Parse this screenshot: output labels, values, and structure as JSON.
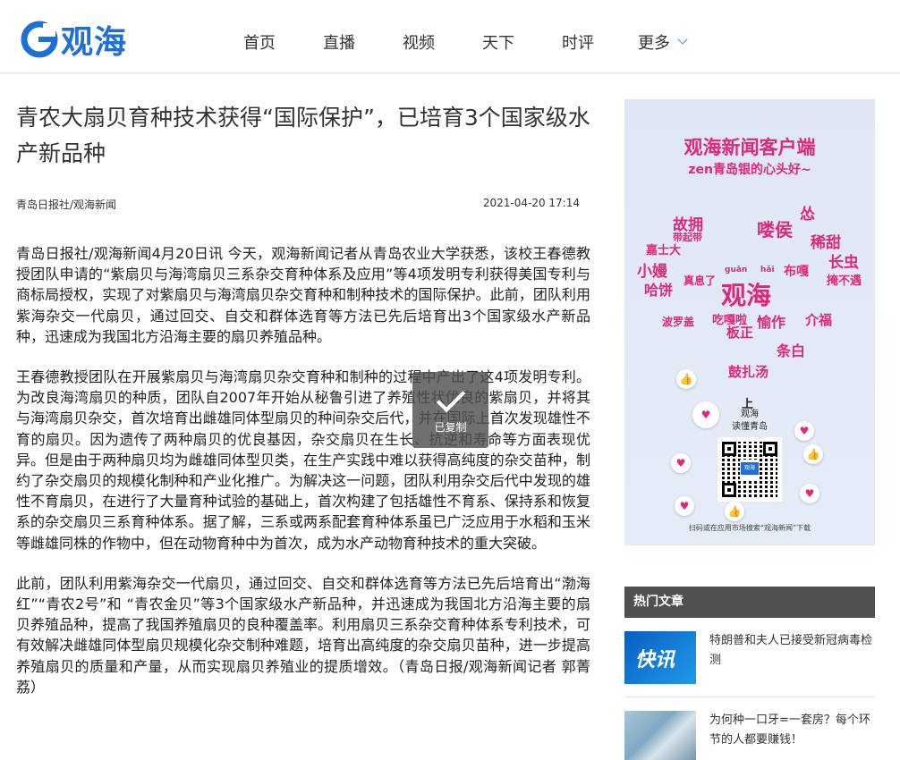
{
  "header": {
    "logo_text": "观海",
    "nav": [
      "首页",
      "直播",
      "视频",
      "天下",
      "时评",
      "更多"
    ]
  },
  "article": {
    "title": "青农大扇贝育种技术获得“国际保护”，已培育3个国家级水产新品种",
    "source": "青岛日报社/观海新闻",
    "time": "2021-04-20 17:14",
    "paragraphs": [
      "青岛日报社/观海新闻4月20日讯 今天，观海新闻记者从青岛农业大学获悉，该校王春德教授团队申请的“紫扇贝与海湾扇贝三系杂交育种体系及应用”等4项发明专利获得美国专利与商标局授权，实现了对紫扇贝与海湾扇贝杂交育种和制种技术的国际保护。此前，团队利用紫海杂交一代扇贝，通过回交、自交和群体选育等方法已先后培育出3个国家级水产新品种，迅速成为我国北方沿海主要的扇贝养殖品种。",
      "王春德教授团队在开展紫扇贝与海湾扇贝杂交育种和制种的过程中产出了这4项发明专利。为改良海湾扇贝的种质，团队自2007年开始从秘鲁引进了养殖性状优良的紫扇贝，并将其与海湾扇贝杂交，首次培育出雌雄同体型扇贝的种间杂交后代，并在国际上首次发现雄性不育的扇贝。因为遗传了两种扇贝的优良基因，杂交扇贝在生长、抗逆和寿命等方面表现优异。但是由于两种扇贝均为雌雄同体型贝类，在生产实践中难以获得高纯度的杂交苗种，制约了杂交扇贝的规模化制种和产业化推广。为解决这一问题，团队利用杂交后代中发现的雄性不育扇贝，在进行了大量育种试验的基础上，首次构建了包括雄性不育系、保持系和恢复系的杂交扇贝三系育种体系。据了解，三系或两系配套育种体系虽已广泛应用于水稻和玉米等雌雄同株的作物中，但在动物育种中为首次，成为水产动物育种技术的重大突破。",
      "此前，团队利用紫海杂交一代扇贝，通过回交、自交和群体选育等方法已先后培育出“渤海红”“青农2号”和 “青农金贝”等3个国家级水产新品种，并迅速成为我国北方沿海主要的扇贝养殖品种，提高了我国养殖扇贝的良种覆盖率。利用扇贝三系杂交育种体系专利技术，可有效解决雌雄同体型扇贝规模化杂交制种难题，培育出高纯度的杂交扇贝苗种，进一步提高养殖扇贝的质量和产量，从而实现扇贝养殖业的提质增效。（青岛日报/观海新闻记者 郭菁荔）"
    ]
  },
  "toast": {
    "label": "已复制"
  },
  "ad": {
    "title": "观海新闻客户端",
    "subtitle": "zen青岛银的心头好~",
    "words": [
      "观海",
      "喽侯",
      "稀甜",
      "长虫",
      "故拥",
      "小嫚",
      "哈饼",
      "板正",
      "愉作",
      "介福",
      "鼓扎汤",
      "条白",
      "真息了",
      "布嘎",
      "掩不遇",
      "嘉士大",
      "带起带",
      "吃嘎啦",
      "波罗盖",
      "怂",
      "guān",
      "hǎi"
    ],
    "arrow": "上",
    "caption_line1": "观海",
    "caption_line2": "读懂青岛",
    "qr_label": "观海",
    "bottom": "扫码或在应用市场搜索“观海新闻”下载"
  },
  "hot": {
    "heading": "热门文章",
    "items": [
      {
        "thumb_text": "快讯",
        "title": "特朗普和夫人已接受新冠病毒检测"
      },
      {
        "thumb_text": "",
        "title": "为何种一口牙=一套房？每个环节的人都要赚钱！"
      }
    ]
  },
  "colors": {
    "brand_blue": "#1e6fd8",
    "ad_pink": "#e0287a",
    "hot_header_bg": "#505050"
  }
}
